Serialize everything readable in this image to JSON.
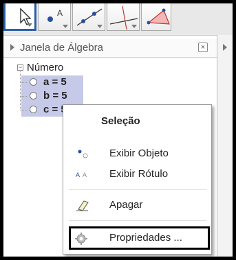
{
  "toolbar": {
    "tools": [
      {
        "name": "move-tool",
        "active": true
      },
      {
        "name": "point-tool",
        "active": false
      },
      {
        "name": "line-tool",
        "active": false
      },
      {
        "name": "perpendicular-line-tool",
        "active": false
      },
      {
        "name": "polygon-tool",
        "active": false
      }
    ]
  },
  "algebra_panel": {
    "title": "Janela de Álgebra",
    "close_label": "×",
    "tree": {
      "category": "Número",
      "items": [
        "a = 5",
        "b = 5",
        "c = 5"
      ]
    }
  },
  "context_menu": {
    "title": "Seleção",
    "items": [
      {
        "label": "Exibir Objeto",
        "icon": "show-object-icon"
      },
      {
        "label": "Exibir Rótulo",
        "icon": "show-label-icon"
      },
      {
        "label": "Apagar",
        "icon": "eraser-icon"
      }
    ],
    "properties_label": "Propriedades ...",
    "properties_icon": "gear-icon"
  },
  "colors": {
    "selection": "#c7c9e8",
    "active_tool_border": "#2a5ea8"
  }
}
